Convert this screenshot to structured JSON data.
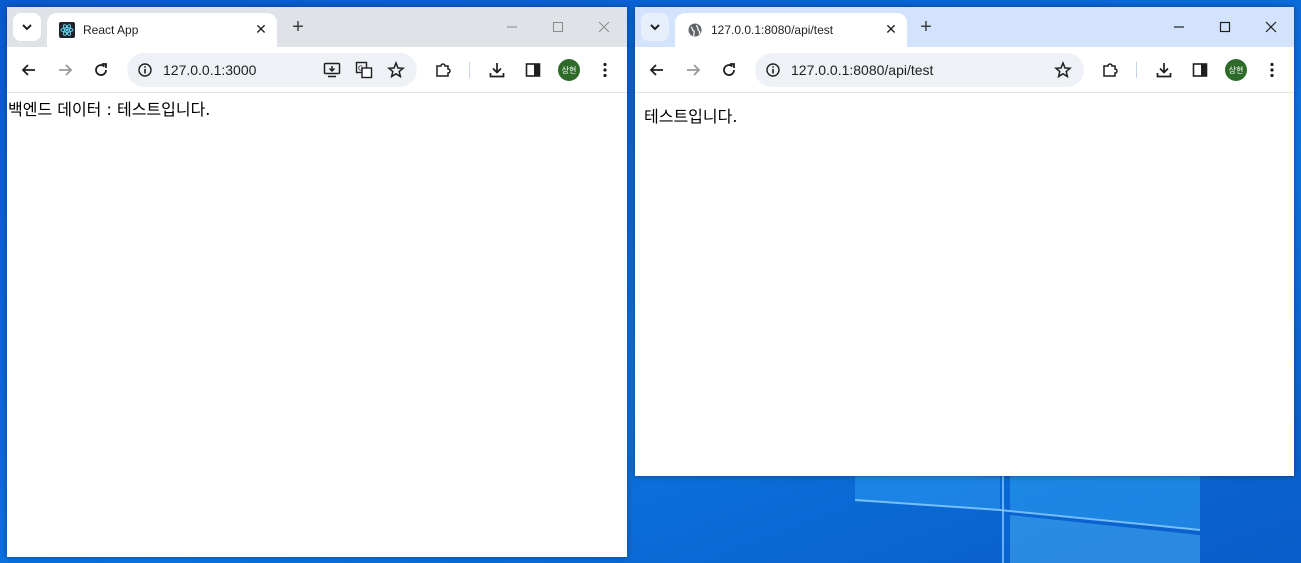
{
  "left_window": {
    "tab_title": "React App",
    "url": "127.0.0.1:3000",
    "page_text": "백엔드 데이터 : 테스트입니다.",
    "avatar_text": "상현",
    "tabstrip_color": "#dfe3e8"
  },
  "right_window": {
    "tab_title": "127.0.0.1:8080/api/test",
    "url": "127.0.0.1:8080/api/test",
    "page_text": "테스트입니다.",
    "avatar_text": "상현",
    "tabstrip_color": "#d3e3fd"
  },
  "icons": {
    "react_favicon": "react-logo-icon",
    "globe_favicon": "globe-icon"
  }
}
